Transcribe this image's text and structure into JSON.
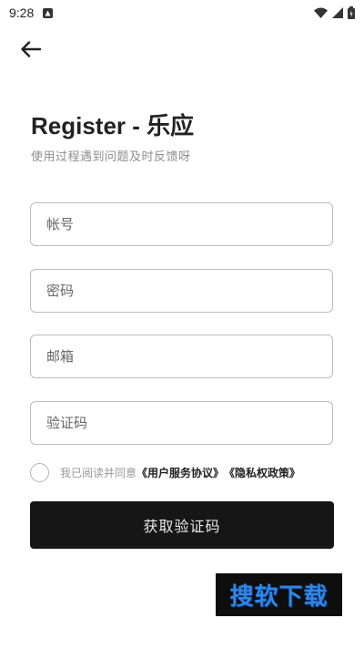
{
  "status_bar": {
    "time": "9:28"
  },
  "header": {
    "title": "Register - 乐应",
    "subtitle": "使用过程遇到问题及时反馈呀"
  },
  "form": {
    "account_placeholder": "帐号",
    "password_placeholder": "密码",
    "email_placeholder": "邮箱",
    "code_placeholder": "验证码"
  },
  "agreement": {
    "prefix": "我已阅读并同意",
    "user_agreement": "《用户服务协议》",
    "privacy_policy": "《隐私权政策》",
    "checked": false
  },
  "actions": {
    "get_code_label": "获取验证码"
  },
  "watermark": {
    "text": "搜软下载"
  },
  "colors": {
    "background": "#ffffff",
    "primary_button": "#161616",
    "field_border": "#bdbdbd",
    "subtitle": "#8d8d8d",
    "watermark_text": "#2f86e6"
  },
  "icons": {
    "back": "arrow-left-icon",
    "notification": "app-notification-icon",
    "wifi": "wifi-icon",
    "signal": "signal-icon",
    "battery": "battery-icon"
  }
}
